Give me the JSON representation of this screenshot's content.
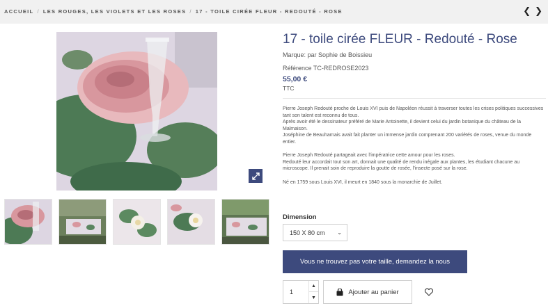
{
  "breadcrumb": {
    "items": [
      "ACCUEIL",
      "LES ROUGES, LES VIOLETS ET LES ROSES",
      "17 - TOILE CIRÉE FLEUR - REDOUTÉ - ROSE"
    ],
    "separator": "/"
  },
  "nav": {
    "prev_icon": "chevron-left-icon",
    "next_icon": "chevron-right-icon"
  },
  "product": {
    "title": "17 - toile cirée FLEUR - Redouté - Rose",
    "brand": "Marque: par Sophie de Boissieu",
    "reference": "Référence TC-REDROSE2023",
    "price": "55,00 €",
    "tax_label": "TTC",
    "description": [
      "Pierre Joseph Redouté proche de Louis XVI puis de Napoléon réussit à traverser toutes les crises politiques successives tant son talent est reconnu de tous.",
      "Après avoir été le dessinateur préféré de Marie Antoinette, il devient celui du jardin botanique du château de la Malmaison.",
      "Joséphine de Beauharnais avait fait planter un immense jardin comprenant 200 variétés de roses, venue du monde entier.",
      "",
      "Pierre Joseph Redouté partageait avec l'impératrice cette amour pour les roses.",
      "Redouté leur accordait tout son art, donnait une qualité de rendu inégale aux plantes, les étudiant chacune au microscope. Il prenait soin de reproduire la goutte de rosée, l'insecte posé sur la rose.",
      "",
      "Né en 1759 sous Louis XVI, il meurt en 1840 sous la monarchie de Juillet."
    ]
  },
  "dimension": {
    "label": "Dimension",
    "selected": "150 X 80 cm"
  },
  "cta": {
    "label": "Vous ne trouvez pas votre taille, demandez la nous"
  },
  "cart": {
    "quantity": "1",
    "add_label": "Ajouter au panier"
  },
  "colors": {
    "accent": "#3d4a7d",
    "breadcrumb_bg": "#f1f1f1"
  }
}
